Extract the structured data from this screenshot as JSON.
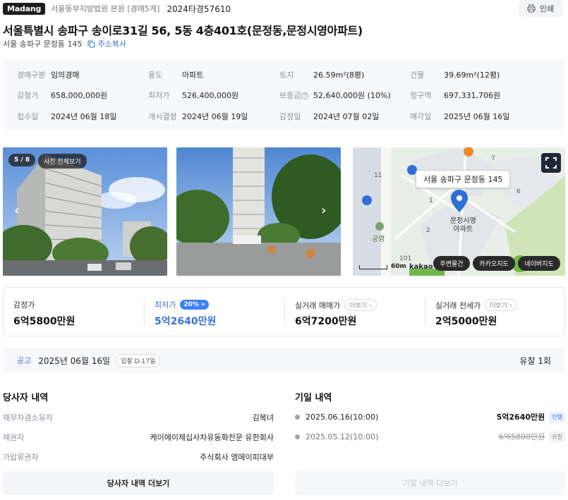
{
  "header": {
    "brand": "Madang",
    "court": "서울동부지방법원 본원 [경매5계]",
    "case_no": "2024타경57610",
    "print_label": "인쇄"
  },
  "title": "서울특별시 송파구 송이로31길 56, 5동 4층401호(문정동,문정시영아파트)",
  "address": {
    "short": "서울 송파구 문정동 145",
    "copy_label": "주소복사"
  },
  "info": {
    "auction_type": {
      "label": "경매구분",
      "value": "임의경매"
    },
    "usage": {
      "label": "용도",
      "value": "아파트"
    },
    "land": {
      "label": "토지",
      "value": "26.59m²(8평)"
    },
    "building": {
      "label": "건물",
      "value": "39.69m²(12평)"
    },
    "appraisal": {
      "label": "감정가",
      "value": "658,000,000원"
    },
    "minimum": {
      "label": "최저가",
      "value": "526,400,000원"
    },
    "deposit": {
      "label": "보증금",
      "value": "52,640,000원 (10%)"
    },
    "claim": {
      "label": "청구액",
      "value": "697,331,706원"
    },
    "received": {
      "label": "접수일",
      "value": "2024년 06월 18일"
    },
    "started": {
      "label": "개시결정",
      "value": "2024년 06월 19일"
    },
    "appraisal_date": {
      "label": "감정일",
      "value": "2024년 07월 02일"
    },
    "sale_date": {
      "label": "매각일",
      "value": "2025년 06월 16일"
    }
  },
  "photos": {
    "counter": "5 / 8",
    "view_all": "사진 전체보기"
  },
  "map": {
    "pin_label": "서울 송파구 문정동 145",
    "building_label_1": "문정시영",
    "building_label_2": "아파트",
    "park_label": "공영",
    "scale": "60m",
    "provider": "kakao",
    "nums": [
      "11",
      "7",
      "6",
      "1",
      "2",
      "101"
    ],
    "buttons": [
      "주변물건",
      "카카오지도",
      "네이버지도"
    ]
  },
  "prices": {
    "appraisal": {
      "label": "감정가",
      "value": "6억5800만원"
    },
    "minimum": {
      "label": "최저가",
      "badge": "20%",
      "value": "5억2640만원"
    },
    "trade": {
      "label": "실거래 매매가",
      "more": "더보기",
      "value": "6억7200만원"
    },
    "jeonse": {
      "label": "실거래 전세가",
      "more": "더보기",
      "value": "2억5000만원"
    }
  },
  "notice": {
    "label": "공고",
    "date": "2025년 06월 16일",
    "dday": "입찰 D-17일",
    "fail_count": "유찰 1회"
  },
  "parties": {
    "title": "당사자 내역",
    "rows": [
      {
        "label": "채무자겸소유자",
        "value": "김복녀"
      },
      {
        "label": "채권자",
        "value": "케이에이제십사차유동화전문 유한회사"
      },
      {
        "label": "가압류권자",
        "value": "주식회사 엠에이피대부"
      }
    ],
    "more": "당사자 내역 더보기"
  },
  "history": {
    "title": "기일 내역",
    "rows": [
      {
        "date": "2025.06.16(10:00)",
        "price": "5억2640만원",
        "status": "진행"
      },
      {
        "date": "2025.05.12(10:00)",
        "price": "6억5800만원",
        "status": "유찰"
      }
    ],
    "more": "기일 내역 더보기"
  },
  "colors": {
    "accent": "#3a73d6",
    "badge": "#3b82f6",
    "panel": "#f7f8fa"
  }
}
